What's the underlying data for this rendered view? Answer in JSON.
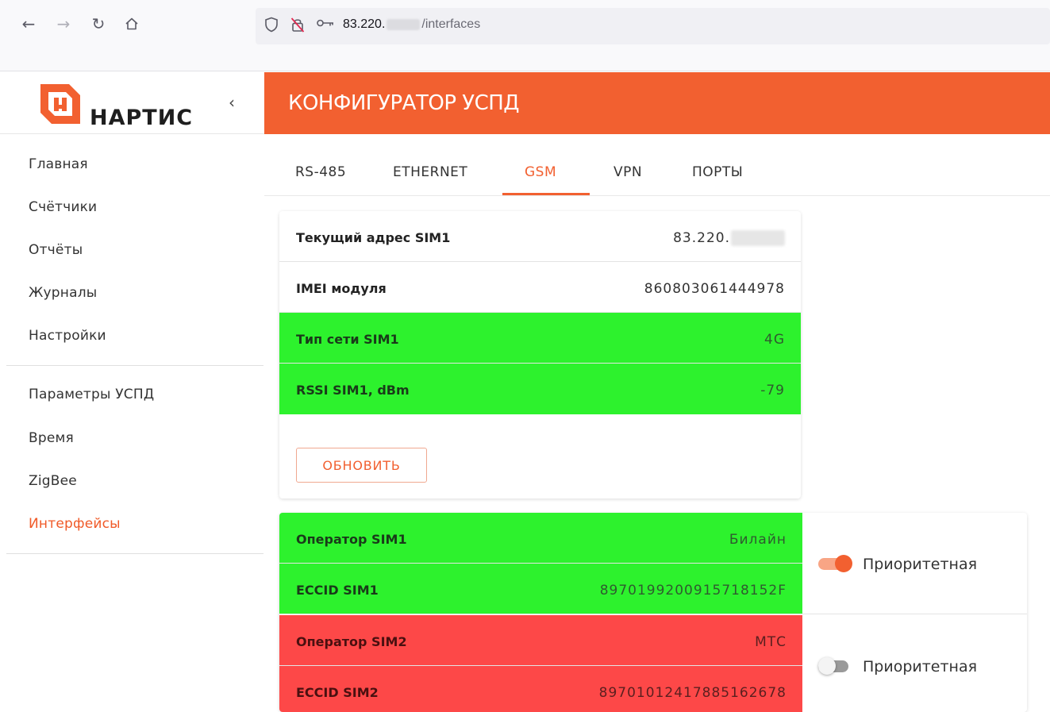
{
  "browser": {
    "back_icon": "back-arrow-icon",
    "forward_icon": "forward-arrow-icon",
    "reload_icon": "reload-icon",
    "home_icon": "home-icon",
    "url_host": "83.220.",
    "url_path": "/interfaces"
  },
  "logo": {
    "text": "НАРТИС"
  },
  "sidebar": {
    "collapse_icon": "chevron-left-icon",
    "items": [
      {
        "label": "Главная"
      },
      {
        "label": "Счётчики"
      },
      {
        "label": "Отчёты"
      },
      {
        "label": "Журналы"
      },
      {
        "label": "Настройки"
      }
    ],
    "items2": [
      {
        "label": "Параметры УСПД"
      },
      {
        "label": "Время"
      },
      {
        "label": "ZigBee"
      },
      {
        "label": "Интерфейсы",
        "active": true
      }
    ]
  },
  "header": {
    "title": "КОНФИГУРАТОР УСПД"
  },
  "tabs": [
    {
      "label": "RS-485"
    },
    {
      "label": "ETHERNET"
    },
    {
      "label": "GSM",
      "active": true
    },
    {
      "label": "VPN"
    },
    {
      "label": "ПОРТЫ"
    }
  ],
  "status": {
    "rows": [
      {
        "label": "Текущий адрес SIM1",
        "value": "83.220."
      },
      {
        "label": "IMEI модуля",
        "value": "860803061444978"
      },
      {
        "label": "Тип сети SIM1",
        "value": "4G"
      },
      {
        "label": "RSSI SIM1, dBm",
        "value": "-79"
      }
    ],
    "refresh_label": "ОБНОВИТЬ"
  },
  "sims": {
    "sim1": {
      "operator_label": "Оператор SIM1",
      "operator_value": "Билайн",
      "eccid_label": "ECCID SIM1",
      "eccid_value": "8970199200915718152F",
      "priority_label": "Приоритетная",
      "priority": true
    },
    "sim2": {
      "operator_label": "Оператор SIM2",
      "operator_value": "МТС",
      "eccid_label": "ECCID SIM2",
      "eccid_value": "89701012417885162678",
      "priority_label": "Приоритетная",
      "priority": false
    }
  },
  "colors": {
    "accent": "#f26030",
    "ok": "#2df22d",
    "error": "#fd4848"
  }
}
